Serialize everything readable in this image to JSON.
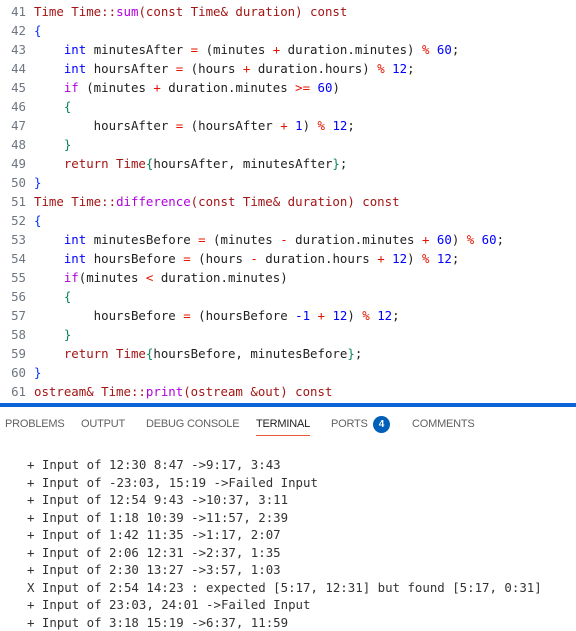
{
  "editor": {
    "lines": [
      {
        "n": "41",
        "tokens": [
          [
            "Time Time::",
            "t-red"
          ],
          [
            "sum",
            "t-ctl"
          ],
          [
            "(const Time& duration) const",
            "t-red"
          ]
        ]
      },
      {
        "n": "42",
        "tokens": [
          [
            "{",
            "t-brace"
          ]
        ]
      },
      {
        "n": "43",
        "tokens": [
          [
            "    int ",
            "t-kw"
          ],
          [
            "minutesAfter ",
            ""
          ],
          [
            "=",
            "t-op"
          ],
          [
            " (minutes ",
            ""
          ],
          [
            "+",
            "t-op"
          ],
          [
            " duration.minutes) ",
            ""
          ],
          [
            "%",
            "t-op"
          ],
          [
            " ",
            ""
          ],
          [
            "60",
            "t-kw"
          ],
          [
            ";",
            ""
          ]
        ]
      },
      {
        "n": "44",
        "tokens": [
          [
            "    int ",
            "t-kw"
          ],
          [
            "hoursAfter ",
            ""
          ],
          [
            "=",
            "t-op"
          ],
          [
            " (hours ",
            ""
          ],
          [
            "+",
            "t-op"
          ],
          [
            " duration.hours) ",
            ""
          ],
          [
            "%",
            "t-op"
          ],
          [
            " ",
            ""
          ],
          [
            "12",
            "t-kw"
          ],
          [
            ";",
            ""
          ]
        ]
      },
      {
        "n": "45",
        "tokens": [
          [
            "    if",
            "t-ctl"
          ],
          [
            " (minutes ",
            ""
          ],
          [
            "+",
            "t-op"
          ],
          [
            " duration.minutes ",
            ""
          ],
          [
            ">=",
            "t-op"
          ],
          [
            " ",
            ""
          ],
          [
            "60",
            "t-kw"
          ],
          [
            ")",
            ""
          ]
        ]
      },
      {
        "n": "46",
        "tokens": [
          [
            "    {",
            "t-num"
          ]
        ]
      },
      {
        "n": "47",
        "tokens": [
          [
            "        hoursAfter ",
            ""
          ],
          [
            "=",
            "t-op"
          ],
          [
            " (hoursAfter ",
            ""
          ],
          [
            "+",
            "t-op"
          ],
          [
            " ",
            ""
          ],
          [
            "1",
            "t-kw"
          ],
          [
            ") ",
            ""
          ],
          [
            "%",
            "t-op"
          ],
          [
            " ",
            ""
          ],
          [
            "12",
            "t-kw"
          ],
          [
            ";",
            ""
          ]
        ]
      },
      {
        "n": "48",
        "tokens": [
          [
            "    }",
            "t-num"
          ]
        ]
      },
      {
        "n": "49",
        "tokens": [
          [
            "    return Time",
            "t-red"
          ],
          [
            "{",
            "t-num"
          ],
          [
            "hoursAfter, minutesAfter",
            ""
          ],
          [
            "}",
            "t-num"
          ],
          [
            ";",
            ""
          ]
        ]
      },
      {
        "n": "50",
        "tokens": [
          [
            "}",
            "t-brace"
          ]
        ]
      },
      {
        "n": "51",
        "tokens": [
          [
            "Time Time::",
            "t-red"
          ],
          [
            "difference",
            "t-ctl"
          ],
          [
            "(const Time& duration) const",
            "t-red"
          ]
        ]
      },
      {
        "n": "52",
        "tokens": [
          [
            "{",
            "t-brace"
          ]
        ]
      },
      {
        "n": "53",
        "tokens": [
          [
            "    int ",
            "t-kw"
          ],
          [
            "minutesBefore ",
            ""
          ],
          [
            "=",
            "t-op"
          ],
          [
            " (minutes ",
            ""
          ],
          [
            "-",
            "t-op"
          ],
          [
            " duration.minutes ",
            ""
          ],
          [
            "+",
            "t-op"
          ],
          [
            " ",
            ""
          ],
          [
            "60",
            "t-kw"
          ],
          [
            ") ",
            ""
          ],
          [
            "%",
            "t-op"
          ],
          [
            " ",
            ""
          ],
          [
            "60",
            "t-kw"
          ],
          [
            ";",
            ""
          ]
        ]
      },
      {
        "n": "54",
        "tokens": [
          [
            "    int ",
            "t-kw"
          ],
          [
            "hoursBefore ",
            ""
          ],
          [
            "=",
            "t-op"
          ],
          [
            " (hours ",
            ""
          ],
          [
            "-",
            "t-op"
          ],
          [
            " duration.hours ",
            ""
          ],
          [
            "+",
            "t-op"
          ],
          [
            " ",
            ""
          ],
          [
            "12",
            "t-kw"
          ],
          [
            ") ",
            ""
          ],
          [
            "%",
            "t-op"
          ],
          [
            " ",
            ""
          ],
          [
            "12",
            "t-kw"
          ],
          [
            ";",
            ""
          ]
        ]
      },
      {
        "n": "55",
        "tokens": [
          [
            "    if",
            "t-ctl"
          ],
          [
            "(minutes ",
            ""
          ],
          [
            "<",
            "t-op"
          ],
          [
            " duration.minutes)",
            ""
          ]
        ]
      },
      {
        "n": "56",
        "tokens": [
          [
            "    {",
            "t-num"
          ]
        ]
      },
      {
        "n": "57",
        "tokens": [
          [
            "        hoursBefore ",
            ""
          ],
          [
            "=",
            "t-op"
          ],
          [
            " (hoursBefore ",
            ""
          ],
          [
            "-1",
            "t-kw"
          ],
          [
            " ",
            ""
          ],
          [
            "+",
            "t-op"
          ],
          [
            " ",
            ""
          ],
          [
            "12",
            "t-kw"
          ],
          [
            ") ",
            ""
          ],
          [
            "%",
            "t-op"
          ],
          [
            " ",
            ""
          ],
          [
            "12",
            "t-kw"
          ],
          [
            ";",
            ""
          ]
        ]
      },
      {
        "n": "58",
        "tokens": [
          [
            "    }",
            "t-num"
          ]
        ]
      },
      {
        "n": "59",
        "tokens": [
          [
            "    return Time",
            "t-red"
          ],
          [
            "{",
            "t-num"
          ],
          [
            "hoursBefore, minutesBefore",
            ""
          ],
          [
            "}",
            "t-num"
          ],
          [
            ";",
            ""
          ]
        ]
      },
      {
        "n": "60",
        "tokens": [
          [
            "}",
            "t-brace"
          ]
        ]
      },
      {
        "n": "61",
        "tokens": [
          [
            "ostream& Time::",
            "t-red"
          ],
          [
            "print",
            "t-ctl"
          ],
          [
            "(ostream &out) const",
            "t-red"
          ]
        ]
      }
    ]
  },
  "panel": {
    "tabs": [
      {
        "label": "PROBLEMS",
        "active": false
      },
      {
        "label": "OUTPUT",
        "active": false
      },
      {
        "label": "DEBUG CONSOLE",
        "active": false
      },
      {
        "label": "TERMINAL",
        "active": true
      },
      {
        "label": "PORTS",
        "active": false,
        "badge": "4"
      },
      {
        "label": "COMMENTS",
        "active": false
      }
    ],
    "accent_color": "#0a66d8",
    "badge_color": "#005fb8"
  },
  "terminal": {
    "lines": [
      "+ Input of 12:30 8:47 ->9:17, 3:43",
      "+ Input of -23:03, 15:19 ->Failed Input",
      "+ Input of 12:54 9:43 ->10:37, 3:11",
      "+ Input of 1:18 10:39 ->11:57, 2:39",
      "+ Input of 1:42 11:35 ->1:17, 2:07",
      "+ Input of 2:06 12:31 ->2:37, 1:35",
      "+ Input of 2:30 13:27 ->3:57, 1:03",
      "X Input of 2:54 14:23 : expected [5:17, 12:31] but found [5:17, 0:31]",
      "+ Input of 23:03, 24:01 ->Failed Input",
      "+ Input of 3:18 15:19 ->6:37, 11:59"
    ]
  }
}
